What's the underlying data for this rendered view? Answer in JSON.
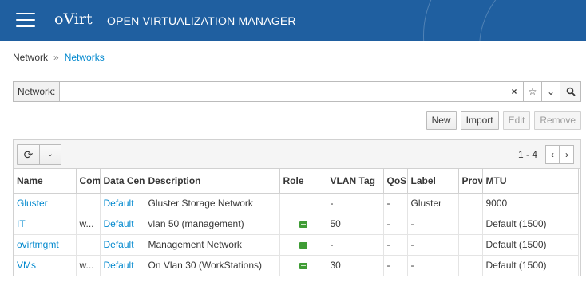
{
  "header": {
    "logo": "oVirt",
    "app_name": "OPEN VIRTUALIZATION MANAGER"
  },
  "breadcrumb": {
    "root": "Network",
    "separator": "»",
    "current": "Networks"
  },
  "search": {
    "label": "Network:",
    "value": "",
    "placeholder": "",
    "clear_icon": "×",
    "star_icon": "☆",
    "caret_icon": "⌄",
    "search_icon": "⚲"
  },
  "toolbar": {
    "new": "New",
    "import": "Import",
    "edit": "Edit",
    "remove": "Remove"
  },
  "grid": {
    "refresh_icon": "⟳",
    "caret_icon": "⌄",
    "page_count": "1 - 4",
    "prev_icon": "‹",
    "next_icon": "›",
    "columns": {
      "name": "Name",
      "comment": "Comment",
      "datacenter": "Data Center",
      "description": "Description",
      "role": "Role",
      "vlan": "VLAN Tag",
      "qos": "QoS",
      "label": "Label",
      "provider": "Provider",
      "mtu": "MTU"
    },
    "rows": [
      {
        "name": "Gluster",
        "comment": "",
        "datacenter": "Default",
        "description": "Gluster Storage Network",
        "role": "",
        "vlan": "-",
        "qos": "-",
        "label": "Gluster",
        "provider": "",
        "mtu": "9000"
      },
      {
        "name": "IT",
        "comment": "w...",
        "datacenter": "Default",
        "description": "vlan 50 (management)",
        "role": "vm",
        "vlan": "50",
        "qos": "-",
        "label": "-",
        "provider": "",
        "mtu": "Default (1500)"
      },
      {
        "name": "ovirtmgmt",
        "comment": "",
        "datacenter": "Default",
        "description": "Management Network",
        "role": "vm",
        "vlan": "-",
        "qos": "-",
        "label": "-",
        "provider": "",
        "mtu": "Default (1500)"
      },
      {
        "name": "VMs",
        "comment": "w...",
        "datacenter": "Default",
        "description": "On Vlan 30 (WorkStations)",
        "role": "vm",
        "vlan": "30",
        "qos": "-",
        "label": "-",
        "provider": "",
        "mtu": "Default (1500)"
      }
    ]
  },
  "colors": {
    "header_bg": "#1f5fa0",
    "link": "#0088ce",
    "vm_badge": "#3f9c35"
  }
}
